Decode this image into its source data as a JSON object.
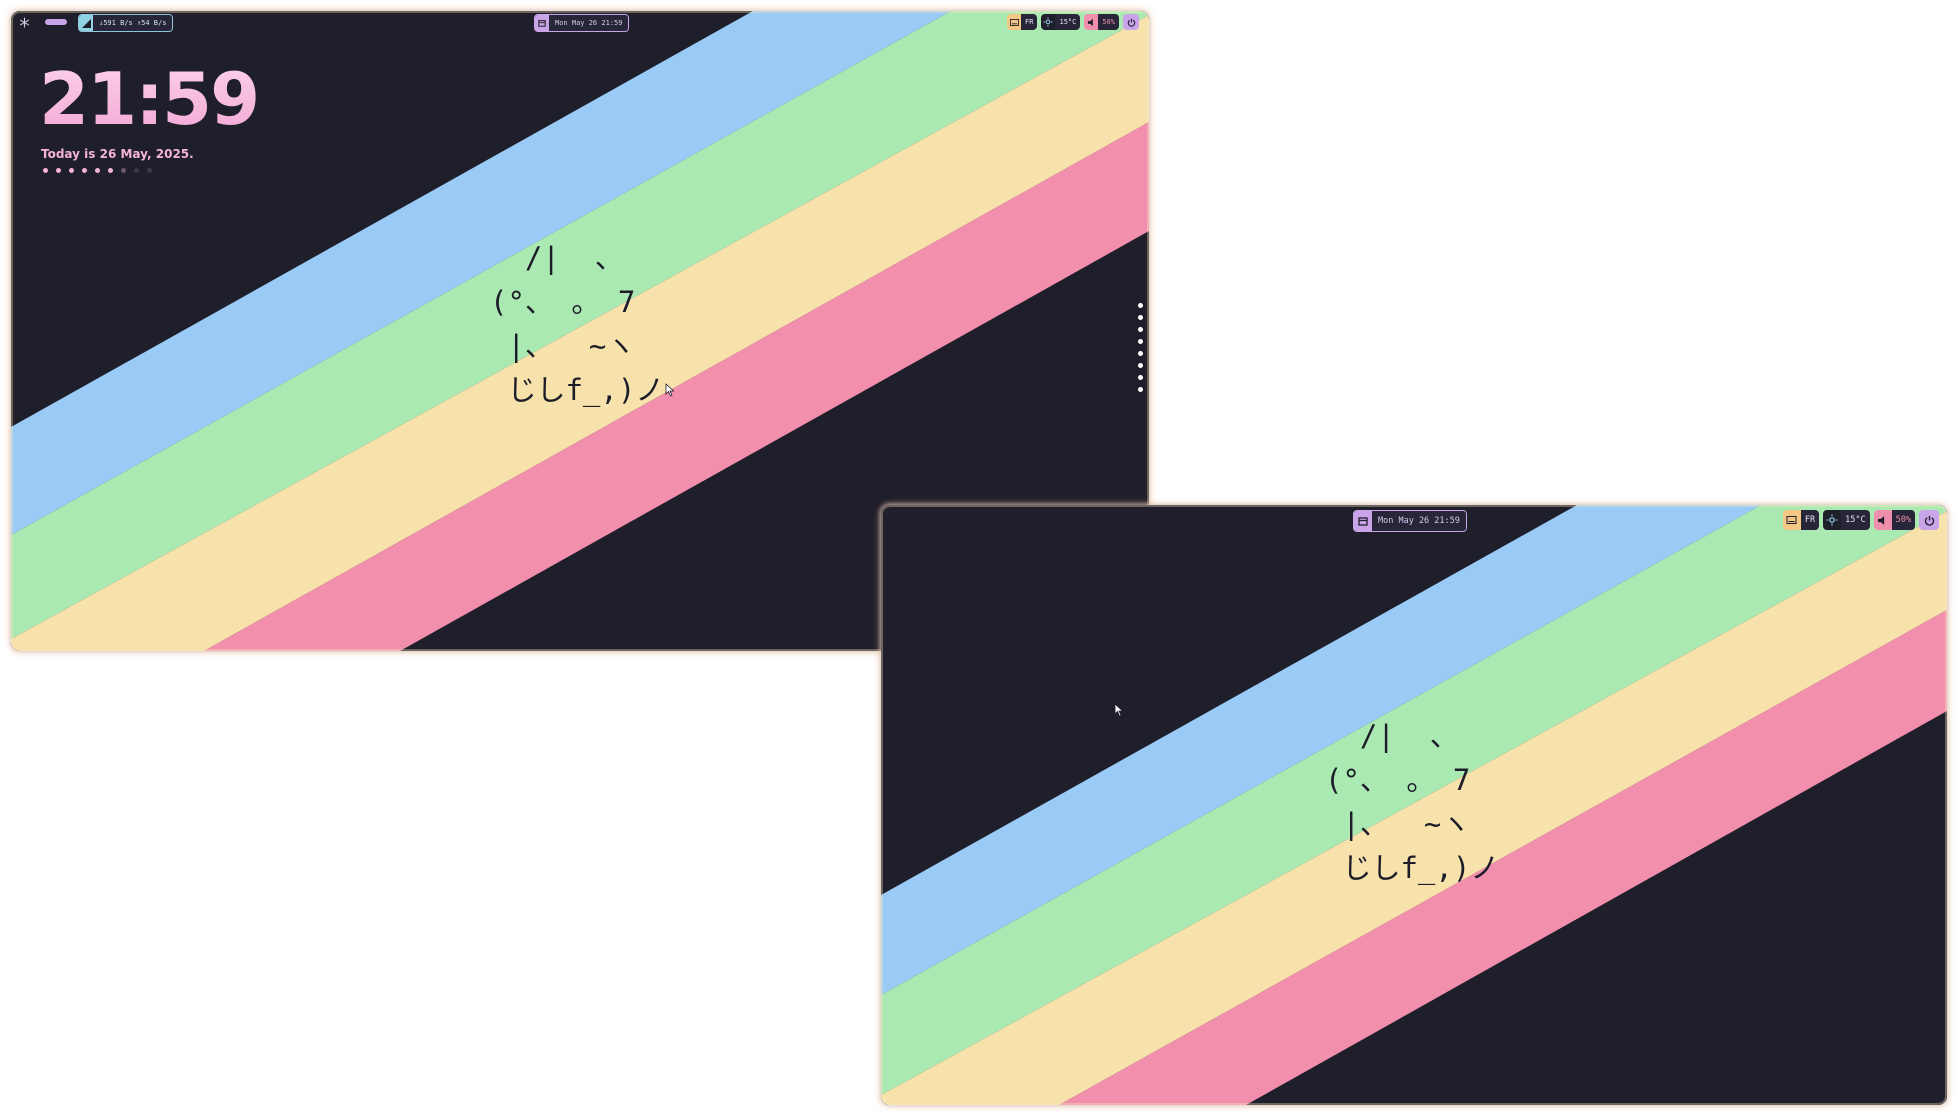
{
  "colors": {
    "background": "#1f1e2b",
    "stripe_blue": "#99cbf6",
    "stripe_green": "#abe9b2",
    "stripe_yellow": "#f8e2ac",
    "stripe_pink": "#f28fad",
    "accent_pink": "#f4b3da",
    "accent_purple": "#c9a4e9"
  },
  "monitor1": {
    "topbar": {
      "launcher_icon": "snowflake-icon",
      "workspace_indicator": "active-workspace-pill",
      "network": {
        "icon": "signal-icon",
        "text": "↓591 B/s ↑54 B/s"
      },
      "datetime": {
        "icon": "calendar-icon",
        "text": "Mon May 26 21:59"
      },
      "keyboard": {
        "icon": "keyboard-icon",
        "layout": "FR"
      },
      "weather": {
        "icon": "sun-icon",
        "temp": "15°C"
      },
      "volume": {
        "icon": "speaker-icon",
        "level": "50%"
      },
      "power": {
        "icon": "power-icon"
      }
    },
    "clock_widget": {
      "time": "21:59",
      "date": "Today is 26 May, 2025.",
      "workspace_dots": 9
    },
    "ascii_cat": [
      "  /|  、",
      "(°、 。 7",
      " |、  ~ヽ",
      " じしf_,)ノ"
    ]
  },
  "monitor2": {
    "topbar": {
      "datetime": {
        "icon": "calendar-icon",
        "text": "Mon May 26 21:59"
      },
      "keyboard": {
        "icon": "keyboard-icon",
        "layout": "FR"
      },
      "weather": {
        "icon": "sun-icon",
        "temp": "15°C"
      },
      "volume": {
        "icon": "speaker-icon",
        "level": "50%"
      },
      "power": {
        "icon": "power-icon"
      }
    },
    "ascii_cat": [
      "  /|  、",
      "(°、 。 7",
      " |、  ~ヽ",
      " じしf_,)ノ"
    ]
  }
}
